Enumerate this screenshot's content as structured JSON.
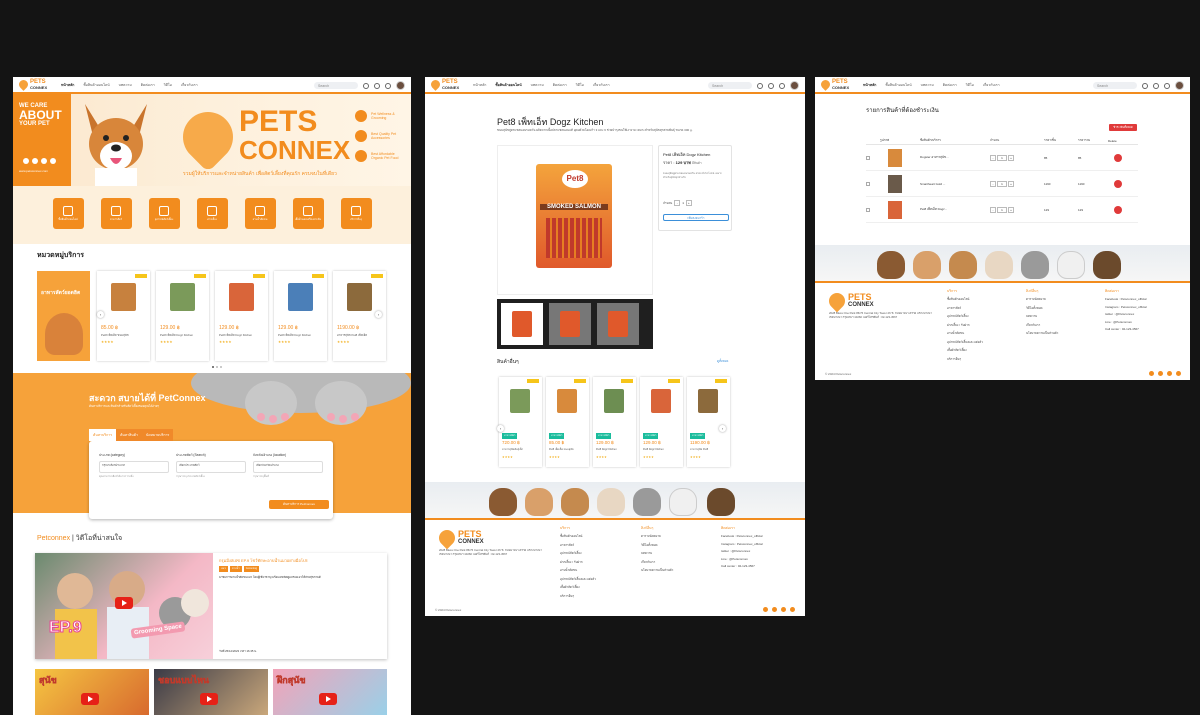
{
  "nav": {
    "logo_main": "PETS",
    "logo_sub": "CONNEX",
    "links": [
      "หน้าหลัก",
      "ซื้อสินค้าออนไลน์",
      "บทความ",
      "ติดต่อเรา",
      "วิดีโอ",
      "เกี่ยวกับเรา"
    ],
    "search_placeholder": "Search"
  },
  "home": {
    "hero_line1": "WE CARE",
    "hero_line2": "ABOUT",
    "hero_line3": "YOUR PET",
    "hero_url": "www.petsconnex.com",
    "brand_main": "PETS",
    "brand_sub": "CONNEX",
    "brand_tag": "รวมผู้ให้บริการและจำหน่ายสินค้า เพื่อสัตว์เลี้ยงที่คุณรัก ครบจบในที่เดียว",
    "features": [
      "Pet Wellness & Grooming",
      "Best Quality Pet Accessories",
      "Best Affordable Organic Pet Food"
    ],
    "categories": [
      "ซื้อสินค้าออนไลน์",
      "อาหารสัตว์",
      "อุปกรณ์สัตว์เลี้ยง",
      "ฝากเลี้ยง",
      "อาบน้ำตัดขน",
      "เสื้อผ้าและเครื่องประดับ",
      "บริการอื่นๆ"
    ],
    "section_title": "หมวดหมู่บริการ",
    "promo_label": "อาหารสัตว์ยอดฮิต",
    "products": [
      {
        "price": "85.00 ฿",
        "name": "Pet8 เพ็ทเอ็ท ขนมสุนัข",
        "stars": "★★★★"
      },
      {
        "price": "129.00 ฿",
        "name": "Pet8 เพ็ทเอ็ท Dogz Kitchen",
        "stars": "★★★★"
      },
      {
        "price": "129.00 ฿",
        "name": "Pet8 เพ็ทเอ็ท Dogz Kitchen",
        "stars": "★★★★"
      },
      {
        "price": "129.00 ฿",
        "name": "Pet8 เพ็ทเอ็ท Dogz Kitchen",
        "stars": "★★★★"
      },
      {
        "price": "1190.00 ฿",
        "name": "อาหารสุนัข Pet8 เพ็ทเอ็ท",
        "stars": "★★★★"
      }
    ],
    "convenient_title": "สะดวก สบายได้ที่ PetConnex",
    "convenient_sub": "ค้นหาบริการและสินค้าสำหรับสัตว์เลี้ยงของคุณได้ง่ายๆ",
    "form_tabs": [
      "ค้นหาบริการ",
      "ค้นหาสินค้า",
      "นัดหมายบริการ"
    ],
    "form_fields": [
      {
        "label": "ประเภท (category)",
        "value": "กรุณาเลือกประเภท",
        "hint": "คุณสามารถเลือกได้มากกว่าหนึ่ง"
      },
      {
        "label": "ประเภทสัตว์ (Search)",
        "value": "เลือกประเภทสัตว์",
        "hint": "กรุณาระบุประเภทสัตว์เลี้ยง"
      },
      {
        "label": "จังหวัด/อำเภอ (location)",
        "value": "เลือกจังหวัด/อำเภอ",
        "hint": "กรุณาระบุพื้นที่"
      }
    ],
    "form_button": "ค้นหาบริการ PetConnex",
    "video_section_brand": "Petconnex",
    "video_section_title": "| วิดีโอที่น่าสนใจ",
    "video_title": "กรุมมิ่งสเปซ EP.9 โชว์ทักษะอาบน้ำแมวอย่างมือโปร",
    "video_tags": [
      "แมว",
      "อาบน้ำ",
      "Grooming"
    ],
    "video_desc": "พาชมการอาบน้ำตัดขนแมว โดยผู้เชี่ยวชาญ พร้อมเทคนิคดูแลขนแมวให้สวยสุขภาพดี",
    "video_date": "วันที่ 25/12/2023 เวลา 16.35 น.",
    "video_ep": "EP.9",
    "video_space": "Grooming Space",
    "small_video_titles": [
      "สุนัข",
      "ชอบแบบไหน",
      "ฝึกสุนัข"
    ]
  },
  "product": {
    "title": "Pet8 เพ็ทเอ็ท Dogz Kitchen",
    "desc": "ขนมสุนัขสูตรแซลมอนรมควัน ผลิตจากเนื้อปลาแซลมอนแท้ อุดมด้วยโอเมก้า 3 และ 6 ช่วยบำรุงขนให้เงางาม เหมาะสำหรับสุนัขทุกสายพันธุ์ ขนาด 300 g.",
    "pack_brand": "Pet8",
    "pack_flavor": "SMOKED SALMON",
    "info_name": "Pet8 เพ็ทเอ็ท Dogz Kitchen",
    "info_price_label": "ราคา :",
    "info_price": "129 บาท",
    "info_stock": "มีสินค้า",
    "info_desc": "ขนมสุนัขสูตรแซลมอนรมควัน อร่อย มีประโยชน์ เหมาะสำหรับสุนัขทุกช่วงวัย",
    "qty_label": "จำนวน",
    "qty_value": "1",
    "add_button": "เพิ่มลงตะกร้า",
    "related_title": "สินค้าอื่นๆ",
    "related_all": "ดูทั้งหมด",
    "related": [
      {
        "tag": "อาหารสัตว์",
        "price": "720.00 ฿",
        "name": "อาหารสุนัขพันธุ์เล็ก",
        "stars": "★★★★"
      },
      {
        "tag": "อาหารสัตว์",
        "price": "85.00 ฿",
        "name": "Pet8 เพ็ทเอ็ท ขนมสุนัข",
        "stars": "★★★★"
      },
      {
        "tag": "อาหารสัตว์",
        "price": "129.00 ฿",
        "name": "Pet8 Dogz Kitchen",
        "stars": "★★★★"
      },
      {
        "tag": "อาหารสัตว์",
        "price": "129.00 ฿",
        "name": "Pet8 Dogz Kitchen",
        "stars": "★★★★"
      },
      {
        "tag": "อาหารสัตว์",
        "price": "1190.00 ฿",
        "name": "อาหารสุนัข Pet8",
        "stars": "★★★★"
      }
    ]
  },
  "cart": {
    "title": "รายการสินค้าที่ต้องชำระเงิน",
    "pay_button": "ชำระเงินทั้งหมด",
    "headers": [
      "",
      "รูปภาพ",
      "ชื่อสินค้า/บริการ",
      "จำนวน",
      "ราคา/ชิ้น",
      "ราคารวม",
      "Delete"
    ],
    "rows": [
      {
        "name": "Dogster อาหารสุนัข...",
        "qty": "1",
        "unit": "85",
        "total": "85"
      },
      {
        "name": "Smartheart Gold ...",
        "qty": "1",
        "unit": "1190",
        "total": "1190"
      },
      {
        "name": "Pet8 เพ็ทเอ็ท Dogz...",
        "qty": "1",
        "unit": "129",
        "total": "129"
      }
    ]
  },
  "footer": {
    "address": "2028 Bless One Park 86/76 Central City Tower 26 ซ. ถนนบางนา-ตราด แขวงบางนา เขตบางนา กรุงเทพฯ 10260 เบอร์โทรศัพท์ : 02-123-4567",
    "col1_title": "บริการ",
    "col1": [
      "ซื้อสินค้าออนไลน์",
      "อาหารสัตว์",
      "อุปกรณ์สัตว์เลี้ยง",
      "ฝากเลี้ยง / รับฝาก",
      "อาบน้ำตัดขน",
      "อุปกรณ์สัตว์เลี้ยงและแต่งตัว",
      "เสื้อผ้าสัตว์เลี้ยง",
      "บริการอื่นๆ"
    ],
    "col2_title": "ลิงก์อื่นๆ",
    "col2": [
      "ตารางนัดหมาย",
      "วิดีโอทั้งหมด",
      "บทความ",
      "เกี่ยวกับเรา",
      "นโยบายความเป็นส่วนตัว"
    ],
    "col3_title": "ติดต่อเรา",
    "col3": [
      "Facebook : Petsconnex_official",
      "Instagram : Petsconnex_official",
      "twitter : @Petsconnex",
      "Line : @Petsconnex",
      "Call center : 02-123-4567"
    ],
    "copyright": "© 2024 Petsconnex"
  },
  "colors": {
    "accent": "#f28c1e",
    "accent_light": "#f6a23a",
    "danger": "#e03a3a",
    "link": "#3b8fd9"
  }
}
